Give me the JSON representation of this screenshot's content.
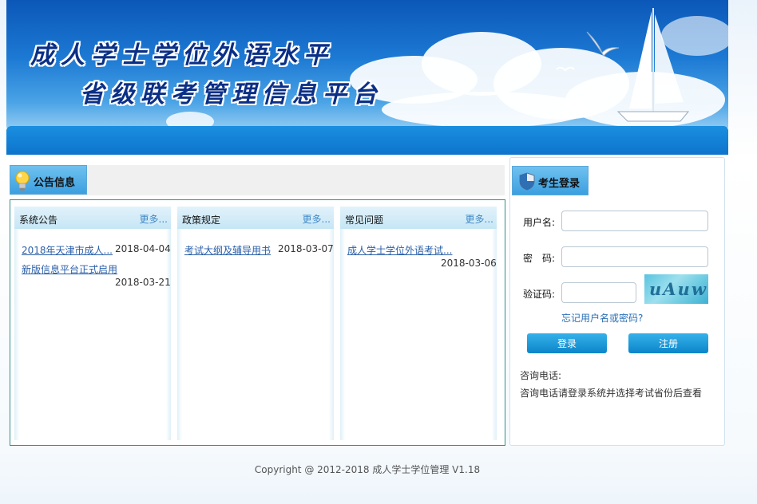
{
  "banner": {
    "title_line1": "成人学士学位外语水平",
    "title_line2": "省级联考管理信息平台"
  },
  "notices": {
    "section_title": "公告信息",
    "columns": [
      {
        "title": "系统公告",
        "more": "更多...",
        "items": [
          {
            "title": "2018年天津市成人...",
            "date": "2018-04-04"
          },
          {
            "title": "新版信息平台正式启用",
            "date": "2018-03-21"
          }
        ]
      },
      {
        "title": "政策规定",
        "more": "更多...",
        "items": [
          {
            "title": "考试大纲及辅导用书",
            "date": "2018-03-07"
          }
        ]
      },
      {
        "title": "常见问题",
        "more": "更多...",
        "items": [
          {
            "title": "成人学士学位外语考试...",
            "date": "2018-03-06"
          }
        ]
      }
    ]
  },
  "login": {
    "title": "考生登录",
    "username_label": "用户名:",
    "username_value": "",
    "password_label": "密　码:",
    "password_value": "",
    "captcha_label": "验证码:",
    "captcha_value": "",
    "captcha_image_text": "uAuw",
    "forgot_link": "忘记用户名或密码?",
    "login_button": "登录",
    "register_button": "注册",
    "phone_label": "咨询电话:",
    "phone_note": "咨询电话请登录系统并选择考试省份后查看"
  },
  "footer": {
    "copyright": "Copyright @ 2012-2018 成人学士学位管理 V1.18"
  },
  "colors": {
    "banner_blue": "#1c79d3",
    "navbar_blue": "#0d74cc",
    "tab_blue": "#3c9fe0",
    "link_blue": "#2a5fa8",
    "box_border": "#2f8f8a"
  }
}
